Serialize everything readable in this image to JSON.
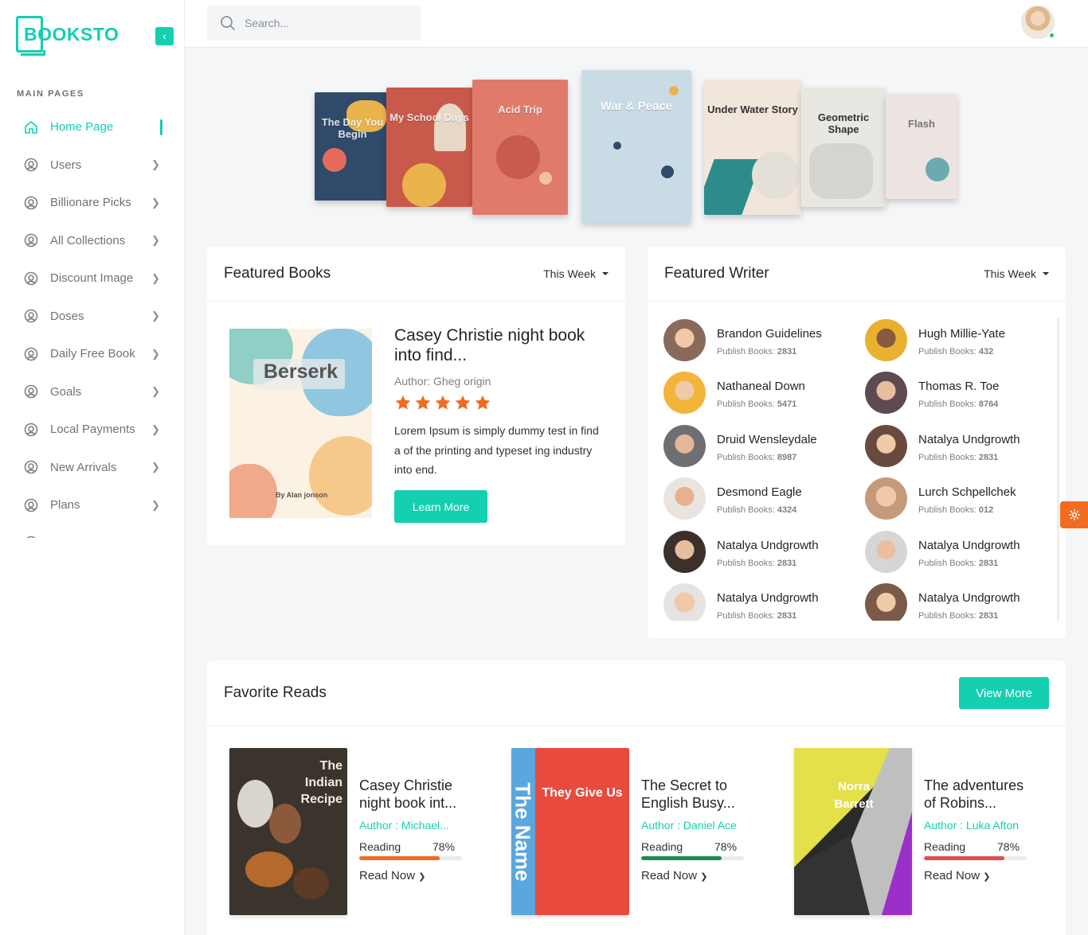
{
  "brand": {
    "name": "BOOKSTO",
    "accent": "#14cfb0"
  },
  "sidebar": {
    "section_title": "MAIN PAGES",
    "items": [
      {
        "label": "Home Page",
        "icon": "home-icon",
        "active": true
      },
      {
        "label": "Users",
        "icon": "user-circle-icon"
      },
      {
        "label": "Billionare Picks",
        "icon": "user-circle-icon"
      },
      {
        "label": "All Collections",
        "icon": "user-circle-icon"
      },
      {
        "label": "Discount Image",
        "icon": "user-circle-icon"
      },
      {
        "label": "Doses",
        "icon": "user-circle-icon"
      },
      {
        "label": "Daily Free Book",
        "icon": "user-circle-icon"
      },
      {
        "label": "Goals",
        "icon": "user-circle-icon"
      },
      {
        "label": "Local Payments",
        "icon": "user-circle-icon"
      },
      {
        "label": "New Arrivals",
        "icon": "user-circle-icon"
      },
      {
        "label": "Plans",
        "icon": "user-circle-icon"
      }
    ]
  },
  "topbar": {
    "search_placeholder": "Search..."
  },
  "carousel": [
    {
      "title": "The Day You Begin",
      "color": "#2f4a6b"
    },
    {
      "title": "My School Days",
      "color": "#c9594a"
    },
    {
      "title": "Acid Trip",
      "color": "#e07a6b"
    },
    {
      "title": "War & Peace",
      "color": "#c9dce6"
    },
    {
      "title": "Under Water Story",
      "color": "#f1e6dc"
    },
    {
      "title": "Geometric Shape",
      "color": "#e9e7e2"
    },
    {
      "title": "Flash",
      "color": "#ece4e0"
    }
  ],
  "featured_books": {
    "title": "Featured Books",
    "filter": "This Week",
    "book": {
      "cover_title": "Berserk",
      "cover_author": "By Alan jonson",
      "title": "Casey Christie night book into find...",
      "author": "Author: Gheg origin",
      "rating": 5,
      "description": "Lorem Ipsum is simply dummy test in find a of the printing and typeset ing industry into end.",
      "button": "Learn More"
    }
  },
  "featured_writer": {
    "title": "Featured Writer",
    "filter": "This Week",
    "count_label": "Publish Books:",
    "writers": [
      {
        "name": "Brandon Guidelines",
        "count": "2831",
        "bg": "#8a6a5a"
      },
      {
        "name": "Hugh Millie-Yate",
        "count": "432",
        "bg": "#e8b130"
      },
      {
        "name": "Nathaneal Down",
        "count": "5471",
        "bg": "#f2b43b"
      },
      {
        "name": "Thomas R. Toe",
        "count": "8764",
        "bg": "#5e4a52"
      },
      {
        "name": "Druid Wensleydale",
        "count": "8987",
        "bg": "#6d6f72"
      },
      {
        "name": "Natalya Undgrowth",
        "count": "2831",
        "bg": "#6a4a3e"
      },
      {
        "name": "Desmond Eagle",
        "count": "4324",
        "bg": "#e9e4df"
      },
      {
        "name": "Lurch Schpellchek",
        "count": "012",
        "bg": "#c59a7a"
      },
      {
        "name": "Natalya Undgrowth",
        "count": "2831",
        "bg": "#3d2f2a"
      },
      {
        "name": "Natalya Undgrowth",
        "count": "2831",
        "bg": "#d8d6d4"
      },
      {
        "name": "Natalya Undgrowth",
        "count": "2831",
        "bg": "#e6e4e2"
      },
      {
        "name": "Natalya Undgrowth",
        "count": "2831",
        "bg": "#7a5a48"
      }
    ]
  },
  "favorite_reads": {
    "title": "Favorite Reads",
    "button": "View More",
    "reading_label": "Reading",
    "link_label": "Read Now",
    "items": [
      {
        "cover_title": "The Indian Recipe",
        "title": "Casey Christie night book int...",
        "author": "Author : Michael...",
        "progress": 78,
        "progress_label": "78%",
        "color": "#f26b21"
      },
      {
        "cover_title": "They Give Us",
        "cover_spine": "The Name",
        "title": "The Secret to English Busy...",
        "author": "Author : Daniel Ace",
        "progress": 78,
        "progress_label": "78%",
        "color": "#1d8a52"
      },
      {
        "cover_title": "Norra Barrett",
        "title": "The adventures of Robins...",
        "author": "Author : Luka Afton",
        "progress": 78,
        "progress_label": "78%",
        "color": "#e24c4c"
      }
    ]
  }
}
